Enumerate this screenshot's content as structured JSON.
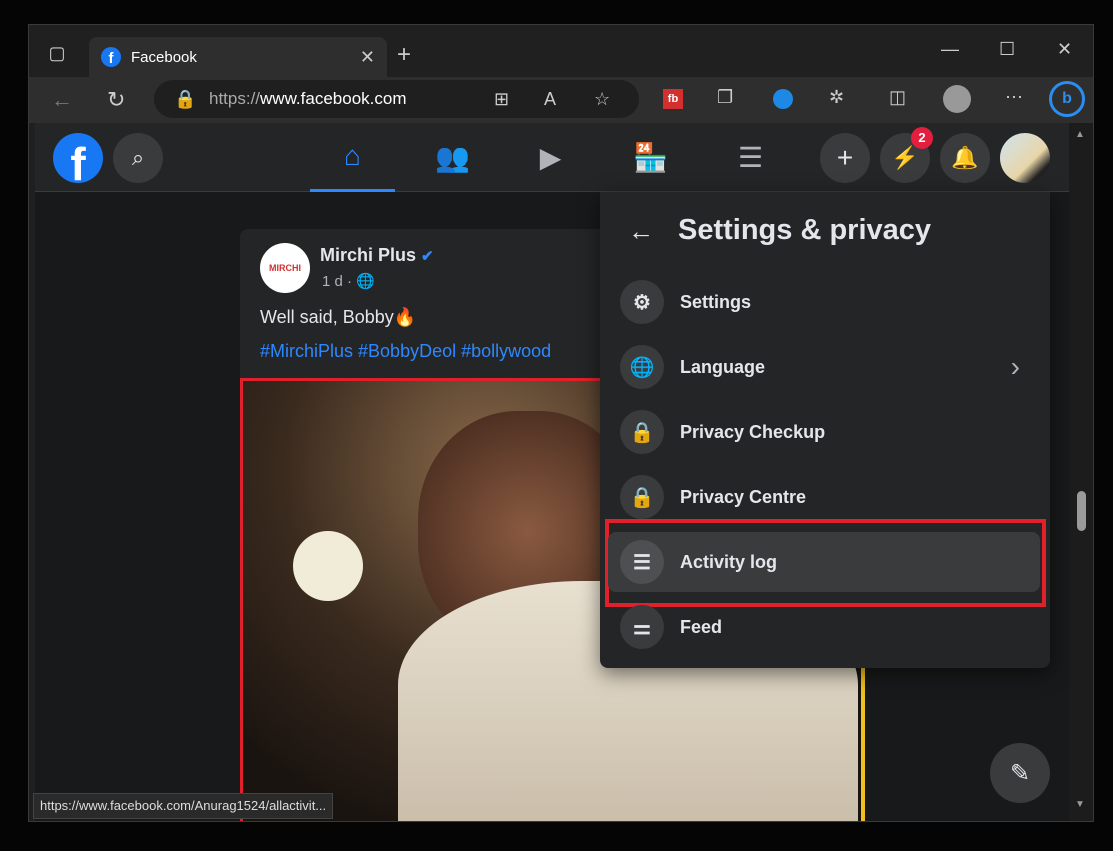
{
  "browser": {
    "tab_title": "Facebook",
    "url_prefix": "https://",
    "url_host": "www.facebook.com",
    "status_url": "https://www.facebook.com/Anurag1524/allactivit..."
  },
  "post": {
    "author": "Mirchi Plus",
    "time": "1 d ·",
    "text": "Well said, Bobby🔥",
    "hashtags": "#MirchiPlus #BobbyDeol #bollywood",
    "avatar_logo": "MIRCHI PLUS"
  },
  "header": {
    "messenger_badge": "2"
  },
  "menu": {
    "title": "Settings & privacy",
    "items": [
      {
        "label": "Settings",
        "icon": "gear-icon",
        "glyph": "⚙"
      },
      {
        "label": "Language",
        "icon": "globe-icon",
        "glyph": "🌐"
      },
      {
        "label": "Privacy Checkup",
        "icon": "lock-heart-icon",
        "glyph": "🔒"
      },
      {
        "label": "Privacy Centre",
        "icon": "lock-icon",
        "glyph": "🔒"
      },
      {
        "label": "Activity log",
        "icon": "list-icon",
        "glyph": "☰"
      },
      {
        "label": "Feed",
        "icon": "sliders-icon",
        "glyph": "⚌"
      }
    ]
  },
  "colors": {
    "accent": "#1877f2",
    "highlight_border": "#e0202a",
    "badge": "#e41e3f"
  }
}
